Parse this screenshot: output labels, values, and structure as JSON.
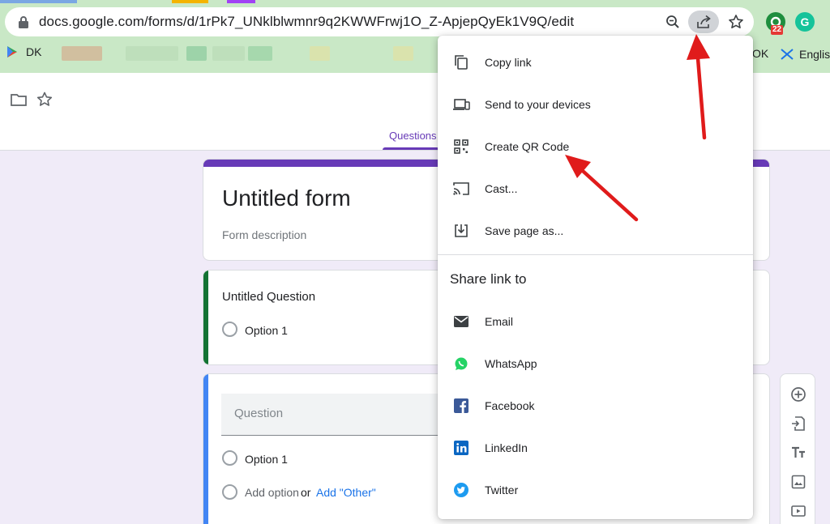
{
  "browser": {
    "url": "docs.google.com/forms/d/1rPk7_UNklblwmnr9q2KWWFrwj1O_Z-ApjepQyEk1V9Q/edit",
    "extension_badge": "22",
    "extension_letter": "G",
    "bookmarks": {
      "first": "DK",
      "right_partial_1": "OK",
      "right_partial_2": "Englis"
    }
  },
  "form": {
    "tab_questions": "Questions",
    "title": "Untitled form",
    "description": "Form description",
    "question1": {
      "title": "Untitled Question",
      "option1": "Option 1"
    },
    "question2": {
      "placeholder": "Question",
      "option1": "Option 1",
      "add_option": "Add option",
      "or": "or",
      "add_other": "Add \"Other\""
    }
  },
  "share_menu": {
    "items": [
      {
        "label": "Copy link",
        "icon": "copy-icon"
      },
      {
        "label": "Send to your devices",
        "icon": "devices-icon"
      },
      {
        "label": "Create QR Code",
        "icon": "qr-code-icon"
      },
      {
        "label": "Cast...",
        "icon": "cast-icon"
      },
      {
        "label": "Save page as...",
        "icon": "save-icon"
      }
    ],
    "share_heading": "Share link to",
    "share_targets": [
      {
        "label": "Email",
        "icon": "email-icon"
      },
      {
        "label": "WhatsApp",
        "icon": "whatsapp-icon"
      },
      {
        "label": "Facebook",
        "icon": "facebook-icon"
      },
      {
        "label": "LinkedIn",
        "icon": "linkedin-icon"
      },
      {
        "label": "Twitter",
        "icon": "twitter-icon"
      }
    ]
  },
  "colors": {
    "forms_accent": "#673ab7",
    "question_active": "#4285f4",
    "question_done": "#137333",
    "annotation_arrow": "#e01b1b",
    "chrome_toolbar": "#c9e8c6"
  }
}
